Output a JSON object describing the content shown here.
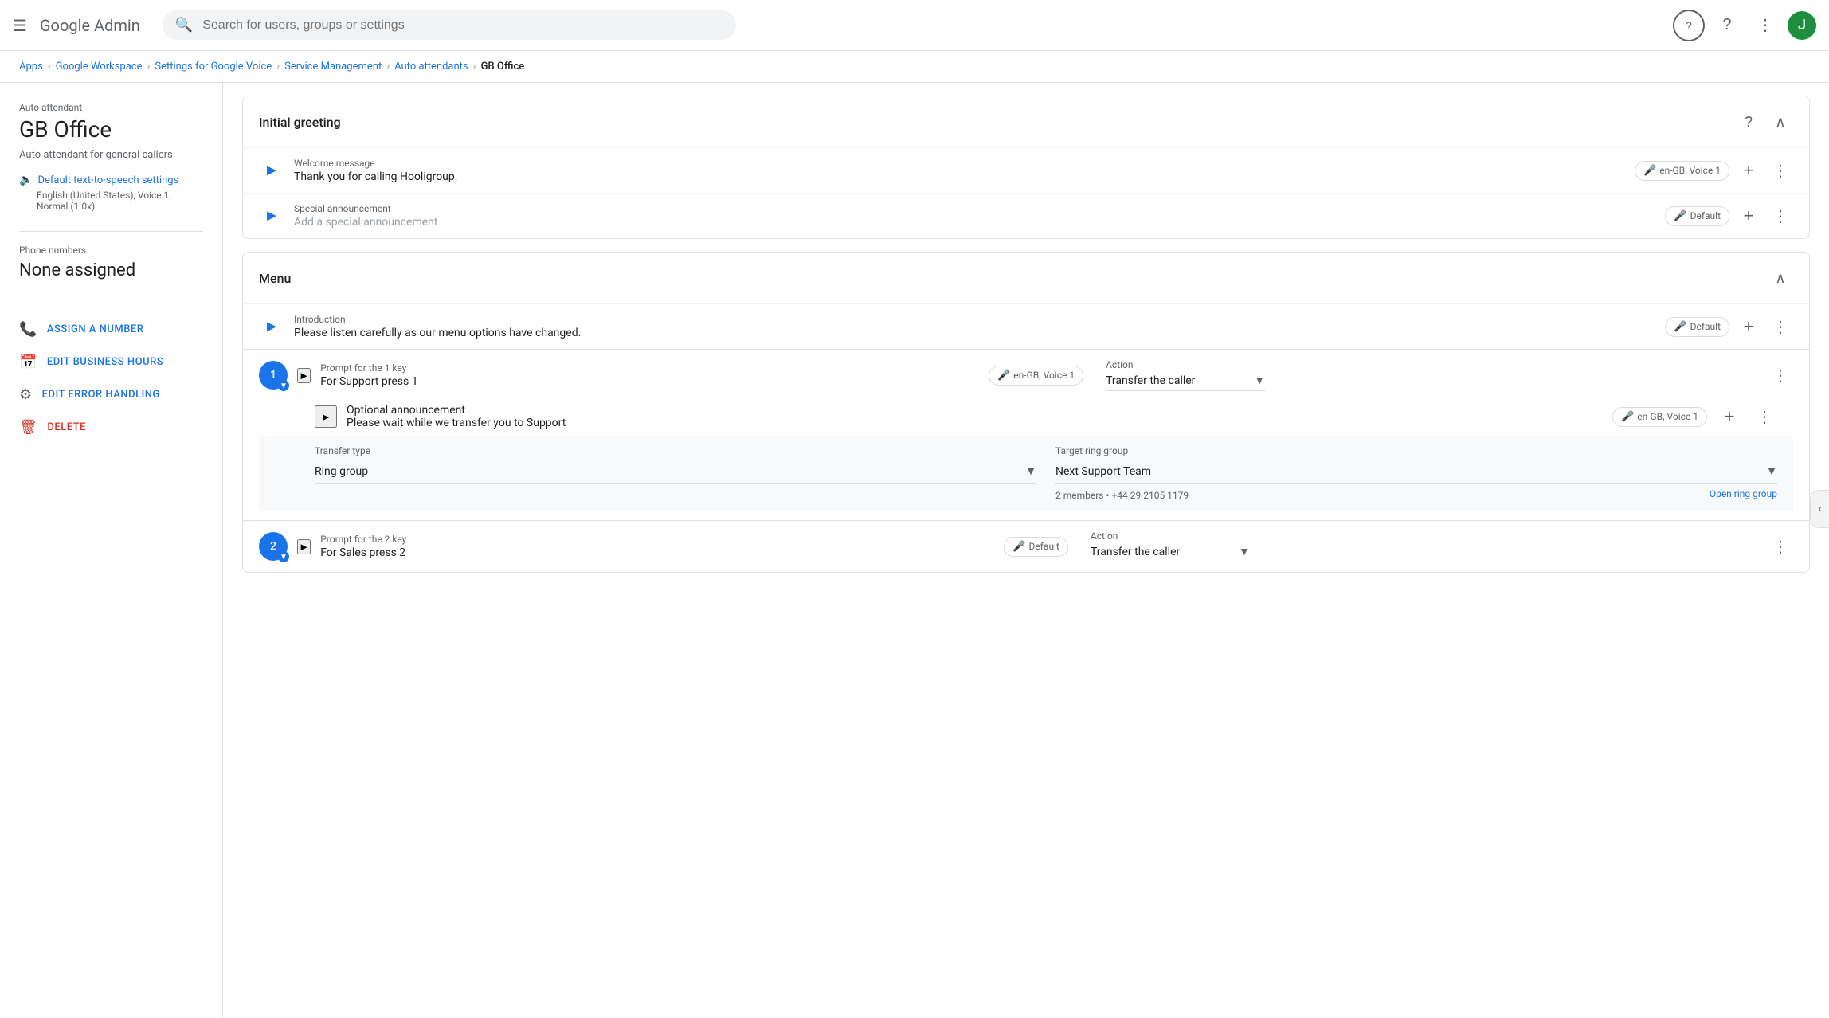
{
  "topNav": {
    "menuIcon": "☰",
    "logoText": "Google Admin",
    "searchPlaceholder": "Search for users, groups or settings",
    "helpBadge": "?",
    "helpIcon": "?",
    "appsIcon": "⋮⋮⋮",
    "avatarInitial": "J"
  },
  "breadcrumb": {
    "items": [
      "Apps",
      "Google Workspace",
      "Settings for Google Voice",
      "Service Management",
      "Auto attendants",
      "GB Office"
    ]
  },
  "sidebar": {
    "autoAttendantLabel": "Auto attendant",
    "officeName": "GB Office",
    "officeDesc": "Auto attendant for general callers",
    "ttsLabel": "Default text-to-speech settings",
    "ttsSub": "English (United States), Voice 1, Normal (1.0x)",
    "phoneNumbersLabel": "Phone numbers",
    "phoneNone": "None assigned",
    "actions": [
      {
        "id": "assign",
        "icon": "📞",
        "label": "ASSIGN A NUMBER"
      },
      {
        "id": "hours",
        "icon": "📅",
        "label": "EDIT BUSINESS HOURS"
      },
      {
        "id": "error",
        "icon": "⚙",
        "label": "EDIT ERROR HANDLING"
      },
      {
        "id": "delete",
        "icon": "🗑",
        "label": "DELETE"
      }
    ]
  },
  "initialGreeting": {
    "sectionTitle": "Initial greeting",
    "welcomeLabel": "Welcome message",
    "welcomeText": "Thank you for calling Hooligroup.",
    "welcomeVoice": "en-GB, Voice 1",
    "specialLabel": "Special announcement",
    "specialPlaceholder": "Add a special announcement",
    "specialVoice": "Default"
  },
  "menu": {
    "sectionTitle": "Menu",
    "introLabel": "Introduction",
    "introText": "Please listen carefully as our menu options have changed.",
    "introVoice": "Default",
    "keys": [
      {
        "keyNum": "1",
        "promptLabel": "Prompt for the 1 key",
        "promptText": "For Support press 1",
        "promptVoice": "en-GB, Voice 1",
        "actionLabel": "Action",
        "actionText": "Transfer the caller",
        "optionalLabel": "Optional announcement",
        "optionalText": "Please wait while we transfer you to Support",
        "optionalVoice": "en-GB, Voice 1",
        "transferTypeLabel": "Transfer type",
        "transferType": "Ring group",
        "targetGroupLabel": "Target ring group",
        "targetGroup": "Next Support Team",
        "targetSub": "2 members • +44 29 2105 1179",
        "openLink": "Open ring group"
      },
      {
        "keyNum": "2",
        "promptLabel": "Prompt for the 2 key",
        "promptText": "For Sales press 2",
        "promptVoice": "Default",
        "actionLabel": "Action",
        "actionText": "Transfer the caller"
      }
    ]
  },
  "icons": {
    "play": "▶",
    "chevronUp": "∧",
    "chevronDown": "∨",
    "add": "+",
    "more": "⋮",
    "mic": "🎤",
    "search": "🔍",
    "dropdown": "▾",
    "collapse": "∧",
    "rightToggle": "‹"
  }
}
